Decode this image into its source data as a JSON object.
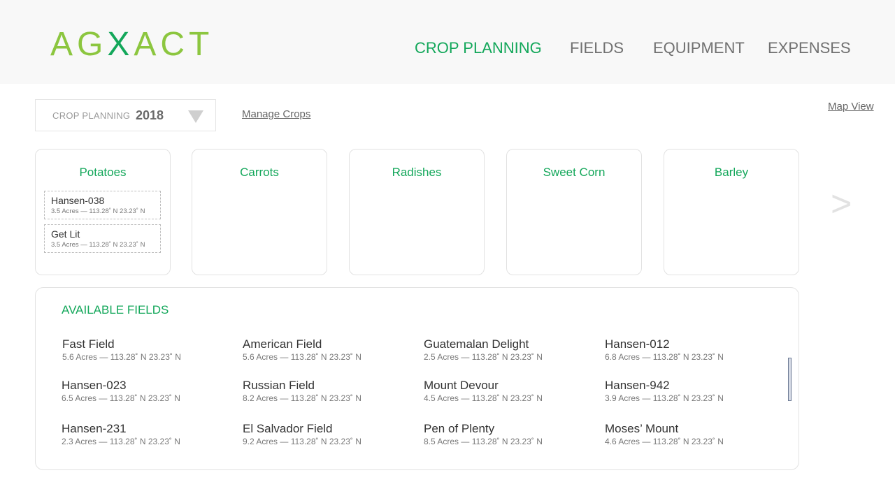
{
  "header": {
    "logo": {
      "part1": "AG",
      "part2": "X",
      "part3": "ACT"
    },
    "nav": [
      "CROP PLANNING",
      "FIELDS",
      "EQUIPMENT",
      "EXPENSES"
    ]
  },
  "toolbar": {
    "select_label": "CROP PLANNING",
    "select_value": "2018",
    "manage_crops": "Manage Crops",
    "map_view": "Map View"
  },
  "crops": [
    {
      "name": "Potatoes",
      "fields": [
        {
          "name": "Hansen-038",
          "meta": "3.5 Acres — 113.28˚ N 23.23˚ N"
        },
        {
          "name": "Get Lit",
          "meta": "3.5 Acres — 113.28˚ N 23.23˚ N"
        }
      ]
    },
    {
      "name": "Carrots",
      "fields": []
    },
    {
      "name": "Radishes",
      "fields": []
    },
    {
      "name": "Sweet Corn",
      "fields": []
    },
    {
      "name": "Barley",
      "fields": []
    }
  ],
  "next_label": ">",
  "available": {
    "title": "AVAILABLE FIELDS",
    "fields": [
      {
        "name": "Fast Field",
        "meta": "5.6 Acres — 113.28˚ N 23.23˚ N"
      },
      {
        "name": "American Field",
        "meta": "5.6 Acres — 113.28˚ N 23.23˚ N"
      },
      {
        "name": "Guatemalan Delight",
        "meta": "2.5 Acres — 113.28˚ N 23.23˚ N"
      },
      {
        "name": "Hansen-012",
        "meta": "6.8 Acres — 113.28˚ N 23.23˚ N"
      },
      {
        "name": "Hansen-023",
        "meta": "6.5 Acres — 113.28˚ N 23.23˚ N"
      },
      {
        "name": "Russian Field",
        "meta": "8.2 Acres — 113.28˚ N 23.23˚ N"
      },
      {
        "name": "Mount Devour",
        "meta": "4.5 Acres — 113.28˚ N 23.23˚ N"
      },
      {
        "name": "Hansen-942",
        "meta": "3.9 Acres — 113.28˚ N 23.23˚ N"
      },
      {
        "name": "Hansen-231",
        "meta": "2.3 Acres — 113.28˚ N 23.23˚ N"
      },
      {
        "name": "El Salvador Field",
        "meta": "9.2 Acres — 113.28˚ N 23.23˚ N"
      },
      {
        "name": "Pen of Plenty",
        "meta": "8.5 Acres — 113.28˚ N 23.23˚ N"
      },
      {
        "name": "Moses’ Mount",
        "meta": "4.6 Acres — 113.28˚ N 23.23˚ N"
      }
    ]
  },
  "colors": {
    "brand_green": "#13a75a",
    "logo_lime": "#8cc63f",
    "nav_gray": "#707070"
  }
}
